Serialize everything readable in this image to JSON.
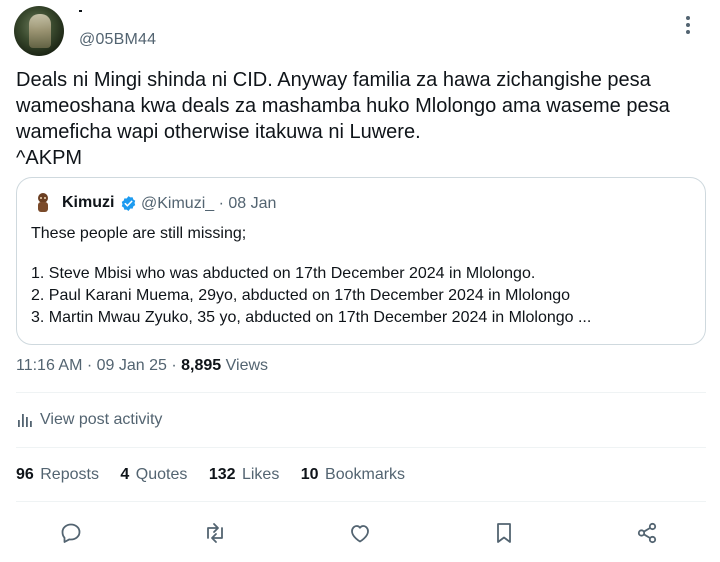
{
  "author": {
    "name": "-",
    "handle": "@05BM44"
  },
  "tweet": {
    "lines": [
      "Deals ni Mingi shinda ni CID. Anyway familia za hawa zichangishe pesa",
      "wameoshana kwa deals za mashamba huko Mlolongo ama waseme pesa",
      "wameficha wapi otherwise itakuwa ni Luwere.",
      "^AKPM"
    ]
  },
  "quote": {
    "name": "Kimuzi",
    "handle": "@Kimuzi_",
    "date": "· 08 Jan",
    "lines": [
      "These people are still missing;",
      "1. Steve Mbisi who was abducted on 17th December 2024 in Mlolongo.",
      "2. Paul Karani Muema, 29yo, abducted on 17th December 2024 in Mlolongo",
      "3. Martin Mwau Zyuko, 35 yo, abducted on 17th December 2024 in Mlolongo ..."
    ]
  },
  "meta": {
    "time": "11:16 AM",
    "date": "· 09 Jan 25 ·",
    "views_count": "8,895",
    "views_label": "Views"
  },
  "activity_label": "View post activity",
  "stats": {
    "reposts_count": "96",
    "reposts_label": "Reposts",
    "quotes_count": "4",
    "quotes_label": "Quotes",
    "likes_count": "132",
    "likes_label": "Likes",
    "bookmarks_count": "10",
    "bookmarks_label": "Bookmarks"
  },
  "icons": {
    "more": "more-icon",
    "verified": "verified-badge-icon",
    "activity": "analytics-icon",
    "reply": "reply-icon",
    "repost": "repost-icon",
    "like": "like-icon",
    "bookmark": "bookmark-icon",
    "share": "share-icon"
  },
  "colors": {
    "text_primary": "#0f1419",
    "text_secondary": "#536471",
    "verified": "#1d9bf0",
    "border": "#cfd9de"
  }
}
